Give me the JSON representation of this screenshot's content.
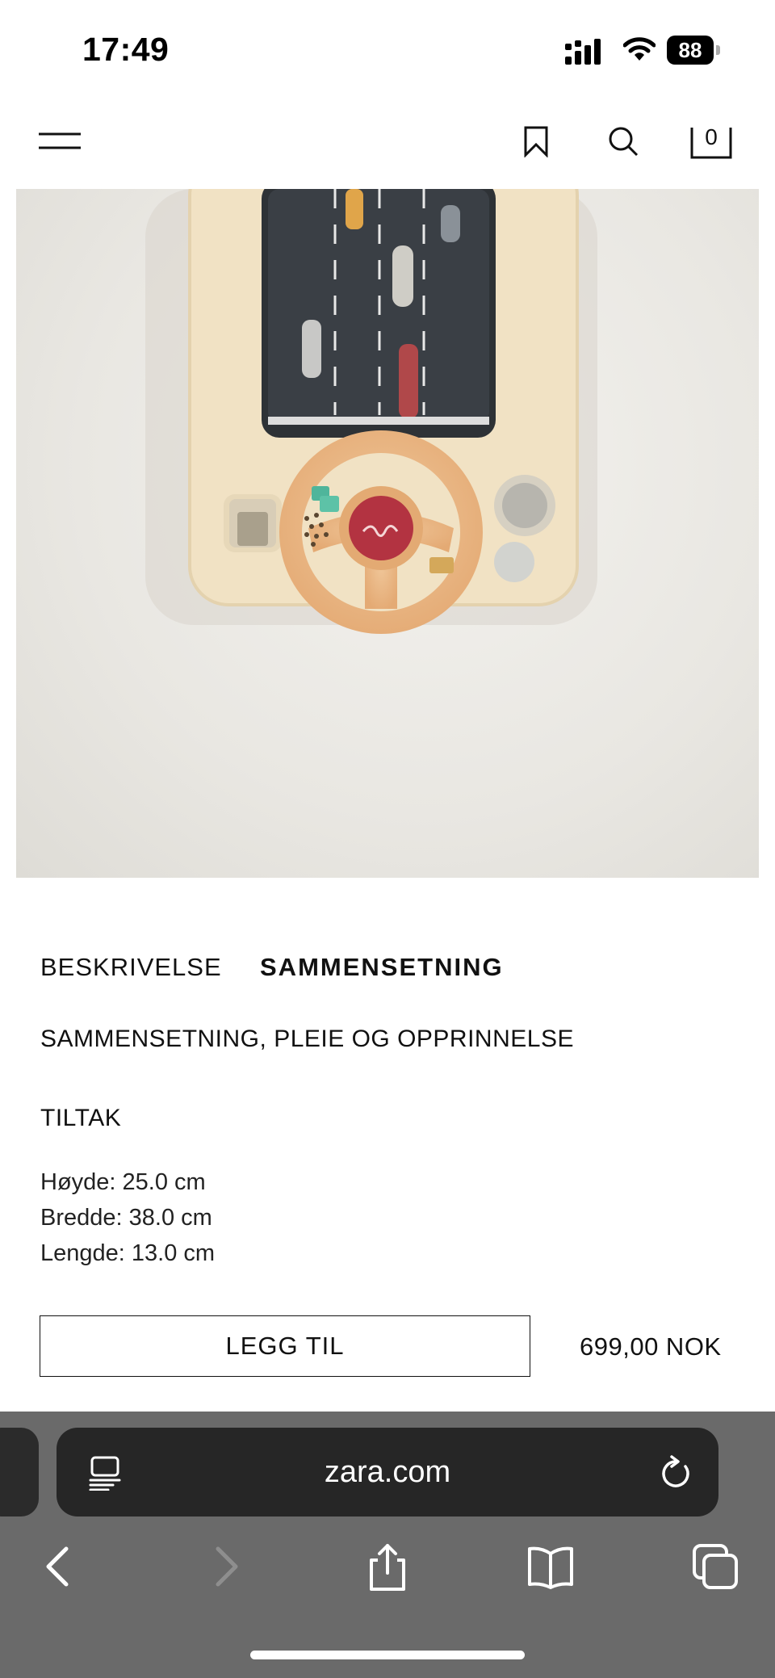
{
  "status_bar": {
    "time": "17:49",
    "battery": "88"
  },
  "header": {
    "bag_count": "0"
  },
  "product": {
    "tabs": [
      {
        "label": "BESKRIVELSE"
      },
      {
        "label": "SAMMENSETNING"
      }
    ],
    "care_heading": "SAMMENSETNING, PLEIE OG OPPRINNELSE",
    "measures_heading": "TILTAK",
    "dimensions": [
      "Høyde: 25.0 cm",
      "Bredde: 38.0 cm",
      "Lengde: 13.0 cm"
    ],
    "add_button_label": "LEGG TIL",
    "price": "699,00 NOK"
  },
  "browser": {
    "url": "zara.com"
  },
  "icons": [
    "signal-icon",
    "wifi-icon",
    "battery-icon",
    "menu-icon",
    "bookmark-icon",
    "search-icon",
    "shopping-bag-icon",
    "reader-icon",
    "reload-icon",
    "back-icon",
    "forward-icon",
    "share-icon",
    "bookmarks-icon",
    "tabs-icon"
  ]
}
